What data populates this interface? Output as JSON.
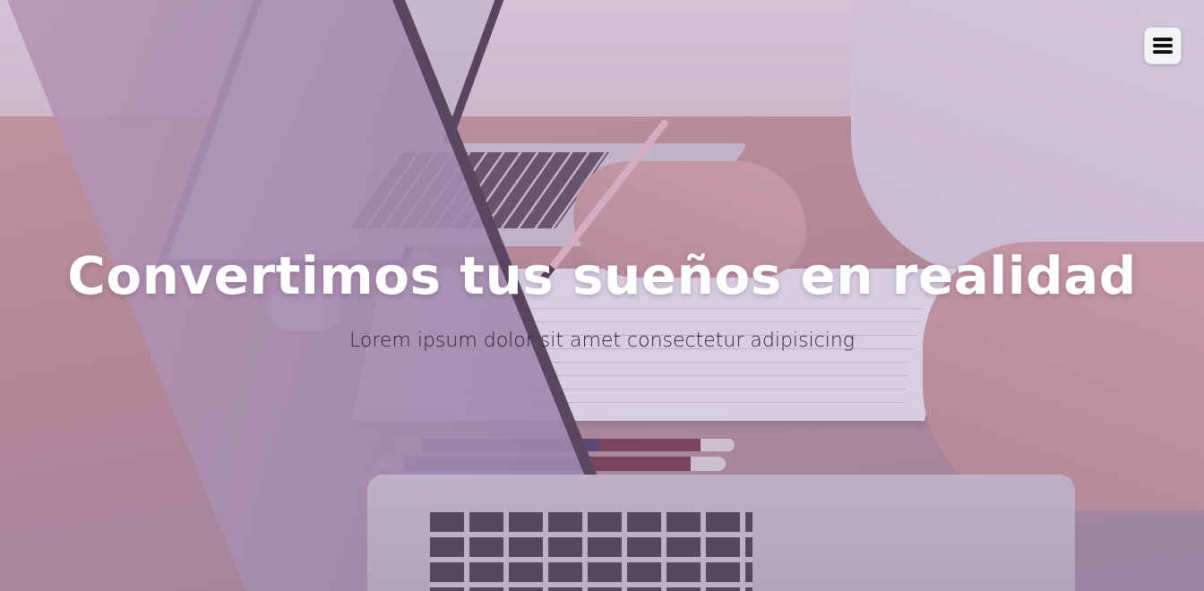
{
  "hero": {
    "title": "Convertimos tus sueños en realidad",
    "subtitle": "Lorem ipsum dolor sit amet consectetur adipisicing"
  },
  "header": {
    "menu_icon": "hamburger-menu-icon"
  },
  "colors": {
    "overlay_tint": "#a078aa",
    "title_text": "#ffffff",
    "subtitle_text": "#2c2530",
    "menu_button_bg": "#f4f4f6"
  }
}
